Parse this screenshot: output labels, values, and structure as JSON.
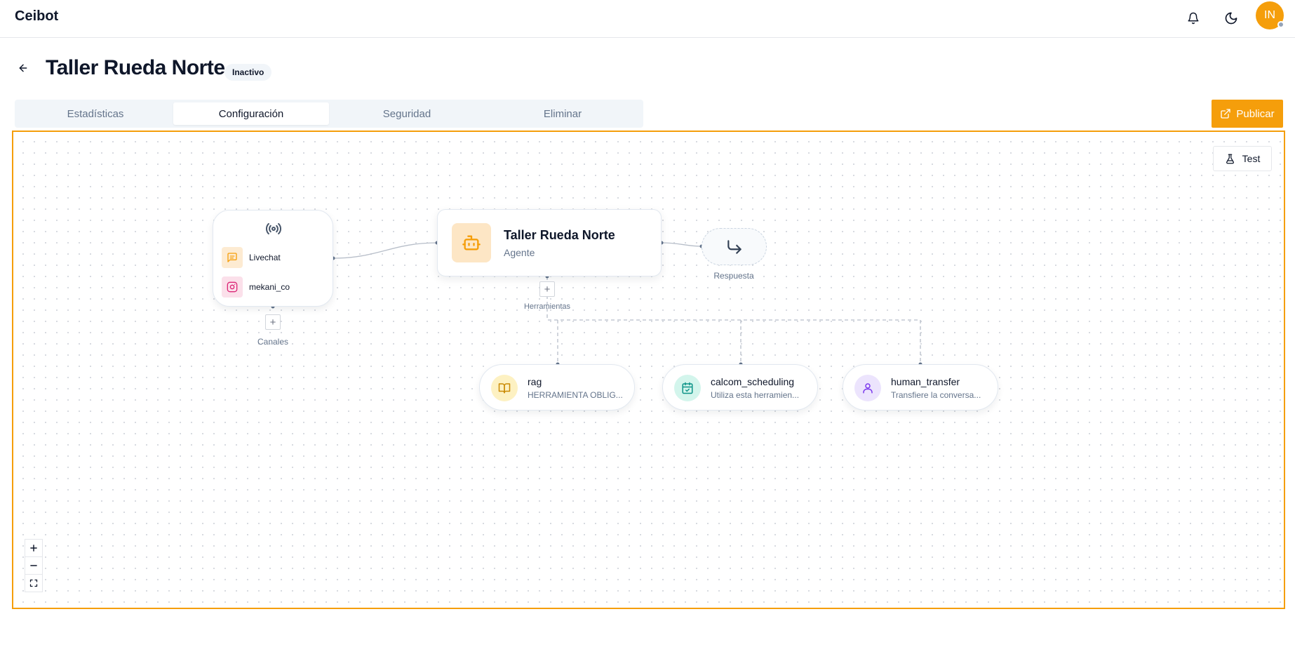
{
  "app": {
    "brand": "Ceibot"
  },
  "topbar": {
    "avatar_initials": "IN",
    "icons": [
      "bell-icon",
      "moon-icon"
    ]
  },
  "header": {
    "title": "Taller Rueda Norte",
    "status": "Inactivo"
  },
  "tabs": [
    {
      "label": "Estadísticas",
      "active": false
    },
    {
      "label": "Configuración",
      "active": true
    },
    {
      "label": "Seguridad",
      "active": false
    },
    {
      "label": "Eliminar",
      "active": false
    }
  ],
  "actions": {
    "publish_label": "Publicar",
    "test_label": "Test"
  },
  "flow": {
    "channels": {
      "items": [
        {
          "label": "Livechat",
          "icon": "chat-icon",
          "color": "#f59e0b"
        },
        {
          "label": "mekani_co",
          "icon": "instagram-icon",
          "color": "#db2777"
        }
      ],
      "caption": "Canales"
    },
    "agent": {
      "title": "Taller Rueda Norte",
      "subtitle": "Agente"
    },
    "response": {
      "caption": "Respuesta"
    },
    "tools_caption": "Herramientas",
    "tools": [
      {
        "name": "rag",
        "description": "HERRAMIENTA OBLIG...",
        "icon": "book-icon",
        "color": "#ca8a04"
      },
      {
        "name": "calcom_scheduling",
        "description": "Utiliza esta herramien...",
        "icon": "calendar-check-icon",
        "color": "#0d9488"
      },
      {
        "name": "human_transfer",
        "description": "Transfiere la conversa...",
        "icon": "user-icon",
        "color": "#7c3aed"
      }
    ]
  },
  "colors": {
    "accent": "#f59e0b",
    "border": "#e2e8f0",
    "muted": "#64748b"
  }
}
